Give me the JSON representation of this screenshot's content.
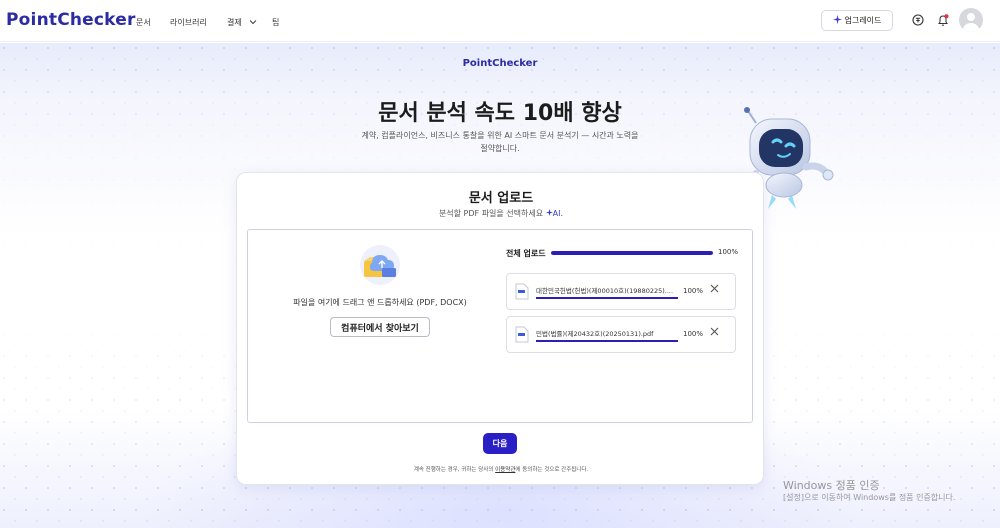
{
  "brand": {
    "logo": "PointChecker",
    "accent": "#2b2ba3",
    "primary_button": "#2a1fc4"
  },
  "nav": {
    "items": [
      {
        "label": "문서"
      },
      {
        "label": "라이브러리"
      },
      {
        "label": "결제"
      },
      {
        "label": "팁"
      }
    ],
    "upgrade_label": "업그레이드",
    "icons": [
      "translate-icon",
      "notification-bell-icon",
      "user-avatar-icon"
    ]
  },
  "hero": {
    "sublogo": "PointChecker",
    "title": "문서 분석 속도 10배 향상",
    "subtitle": "계약, 컴플라이언스, 비즈니스 통찰을 위한 AI 스마트 문서 분석기 — 시간과 노력을 절약합니다."
  },
  "upload": {
    "title": "문서 업로드",
    "subtitle": "분석할 PDF 파일을 선택하세요",
    "ai_label": "AI.",
    "drop_text": "파일을 여기에 드래그 앤 드롭하세요 (PDF, DOCX)",
    "browse_label": "컴퓨터에서 찾아보기",
    "total_label": "전체 업로드",
    "total_progress": 100,
    "total_percent_text": "100%",
    "files": [
      {
        "name": "대한민국헌법(헌법)(제00010호)(19880225)....",
        "progress": 100,
        "percent_text": "100%"
      },
      {
        "name": "민법(법률)(제20432호)(20250131).pdf",
        "progress": 100,
        "percent_text": "100%"
      }
    ],
    "next_label": "다음",
    "terms_prefix": "계속 진행하는 경우, 귀하는 당사의 ",
    "terms_link": "이용약관",
    "terms_suffix": "에 동의하는 것으로 간주됩니다."
  },
  "watermark": {
    "line1": "Windows 정품 인증",
    "line2": "[설정]으로 이동하여 Windows를 정품 인증합니다."
  }
}
